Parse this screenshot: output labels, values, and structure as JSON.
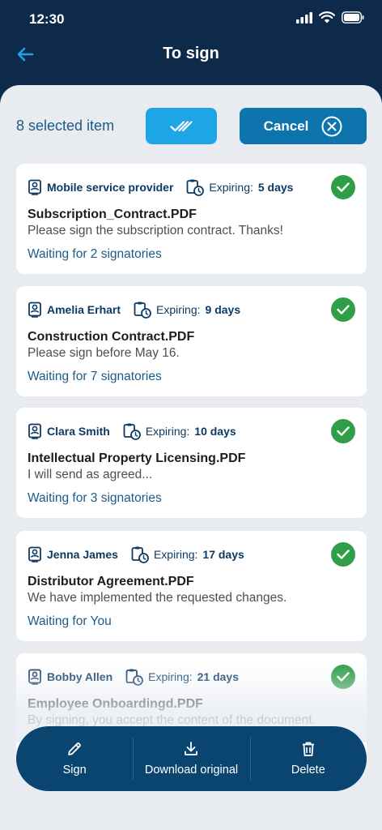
{
  "status_bar": {
    "time": "12:30"
  },
  "nav": {
    "title": "To sign"
  },
  "selection": {
    "count_text": "8 selected item",
    "cancel_label": "Cancel"
  },
  "documents": [
    {
      "sender": "Mobile service provider",
      "expiring_label": "Expiring:",
      "expiring_value": "5 days",
      "title": "Subscription_Contract.PDF",
      "message": "Please sign the subscription contract. Thanks!",
      "status": "Waiting for 2 signatories"
    },
    {
      "sender": "Amelia Erhart",
      "expiring_label": "Expiring:",
      "expiring_value": "9 days",
      "title": "Construction Contract.PDF",
      "message": "Please sign before May 16.",
      "status": "Waiting for 7 signatories"
    },
    {
      "sender": "Clara Smith",
      "expiring_label": "Expiring:",
      "expiring_value": "10 days",
      "title": "Intellectual Property Licensing.PDF",
      "message": "I will send as agreed...",
      "status": "Waiting for 3 signatories"
    },
    {
      "sender": "Jenna James",
      "expiring_label": "Expiring:",
      "expiring_value": "17 days",
      "title": "Distributor Agreement.PDF",
      "message": "We have implemented the requested changes.",
      "status": "Waiting for You"
    },
    {
      "sender": "Bobby Allen",
      "expiring_label": "Expiring:",
      "expiring_value": "21 days",
      "title": "Employee Onboardingd.PDF",
      "message": "By signing, you accept the content of the document.",
      "status": ""
    }
  ],
  "actions": {
    "sign": "Sign",
    "download": "Download original",
    "delete": "Delete"
  },
  "colors": {
    "header_bg": "#0d2a4a",
    "primary": "#0d74ad",
    "accent": "#1ea5e6",
    "check": "#2f9e47",
    "action_bar": "#0a4570"
  }
}
